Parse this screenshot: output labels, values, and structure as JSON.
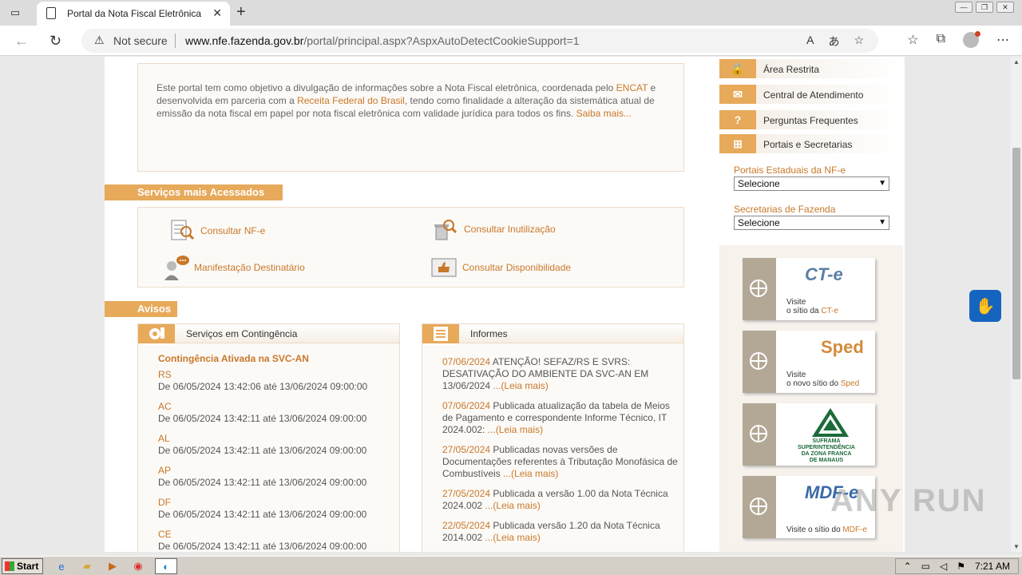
{
  "browser": {
    "tab_title": "Portal da Nota Fiscal Eletrônica",
    "security_label": "Not secure",
    "url_domain": "www.nfe.fazenda.gov.br",
    "url_path": "/portal/principal.aspx?AspxAutoDetectCookieSupport=1"
  },
  "intro": {
    "text_1": "Este portal tem como objetivo a divulgação de informações sobre a Nota Fiscal eletrônica, coordenada pelo ",
    "link_encat": "ENCAT",
    "text_2": " e desenvolvida em parceria com a ",
    "link_rfb": "Receita Federal do Brasil",
    "text_3": ", tendo como finalidade a alteração da sistemática atual de emissão da nota fiscal em papel por nota fiscal eletrônica com validade jurídica para todos os fins. ",
    "link_more": "Saiba mais..."
  },
  "servicos": {
    "title": "Serviços mais Acessados",
    "items": [
      "Consultar NF-e",
      "Consultar Inutilização",
      "Manifestação Destinatário",
      "Consultar Disponibilidade"
    ]
  },
  "avisos": {
    "title": "Avisos"
  },
  "contingencia": {
    "title": "Serviços em Contingência",
    "subtitle": "Contingência Ativada na SVC-AN",
    "items": [
      {
        "state": "RS",
        "period": "De 06/05/2024 13:42:06 até 13/06/2024 09:00:00"
      },
      {
        "state": "AC",
        "period": "De 06/05/2024 13:42:11 até 13/06/2024 09:00:00"
      },
      {
        "state": "AL",
        "period": "De 06/05/2024 13:42:11 até 13/06/2024 09:00:00"
      },
      {
        "state": "AP",
        "period": "De 06/05/2024 13:42:11 até 13/06/2024 09:00:00"
      },
      {
        "state": "DF",
        "period": "De 06/05/2024 13:42:11 até 13/06/2024 09:00:00"
      },
      {
        "state": "CE",
        "period": "De 06/05/2024 13:42:11 até 13/06/2024 09:00:00"
      }
    ]
  },
  "informes": {
    "title": "Informes",
    "items": [
      {
        "date": "07/06/2024",
        "text": " ATENÇÃO! SEFAZ/RS E SVRS: DESATIVAÇÃO DO AMBIENTE DA SVC-AN EM 13/06/2024 ",
        "more": "...(Leia mais)"
      },
      {
        "date": "07/06/2024",
        "text": " Publicada atualização da tabela de Meios de Pagamento e correspondente Informe Técnico, IT 2024.002: ",
        "more": "...(Leia mais)"
      },
      {
        "date": "27/05/2024",
        "text": " Publicadas novas versões de Documentações referentes à Tributação Monofásica de Combustíveis ",
        "more": "...(Leia mais)"
      },
      {
        "date": "27/05/2024",
        "text": " Publicada a versão 1.00 da Nota Técnica 2024.002 ",
        "more": "...(Leia mais)"
      },
      {
        "date": "22/05/2024",
        "text": " Publicada versão 1.20 da Nota Técnica 2014.002 ",
        "more": "...(Leia mais)"
      }
    ]
  },
  "right_menu": {
    "items": [
      "Área Restrita",
      "Central de Atendimento",
      "Perguntas Frequentes",
      "Portais e Secretarias"
    ],
    "portais_label": "Portais Estaduais da NF-e",
    "portais_value": "Selecione",
    "secretarias_label": "Secretarias de Fazenda",
    "secretarias_value": "Selecione"
  },
  "promos": [
    {
      "logo": "CT-e",
      "line1": "Visite",
      "line2": "o sítio da ",
      "link": "CT-e"
    },
    {
      "logo": "Sped",
      "line1": "Visite",
      "line2": "o novo sítio do ",
      "link": "Sped"
    },
    {
      "logo": "SUFRAMA",
      "line1": "SUPERINTENDÊNCIA",
      "line2": "DA ZONA FRANCA",
      "line3": "DE MANAUS"
    },
    {
      "logo": "MDF-e",
      "line1": "Visite o sítio do ",
      "link": "MDF-e"
    }
  ],
  "taskbar": {
    "start_label": "Start",
    "clock": "7:21 AM"
  },
  "watermark": "ANY RUN",
  "colors": {
    "accent": "#e7a95a",
    "link": "#c8782a",
    "panel_bg": "#fcfaf7"
  }
}
